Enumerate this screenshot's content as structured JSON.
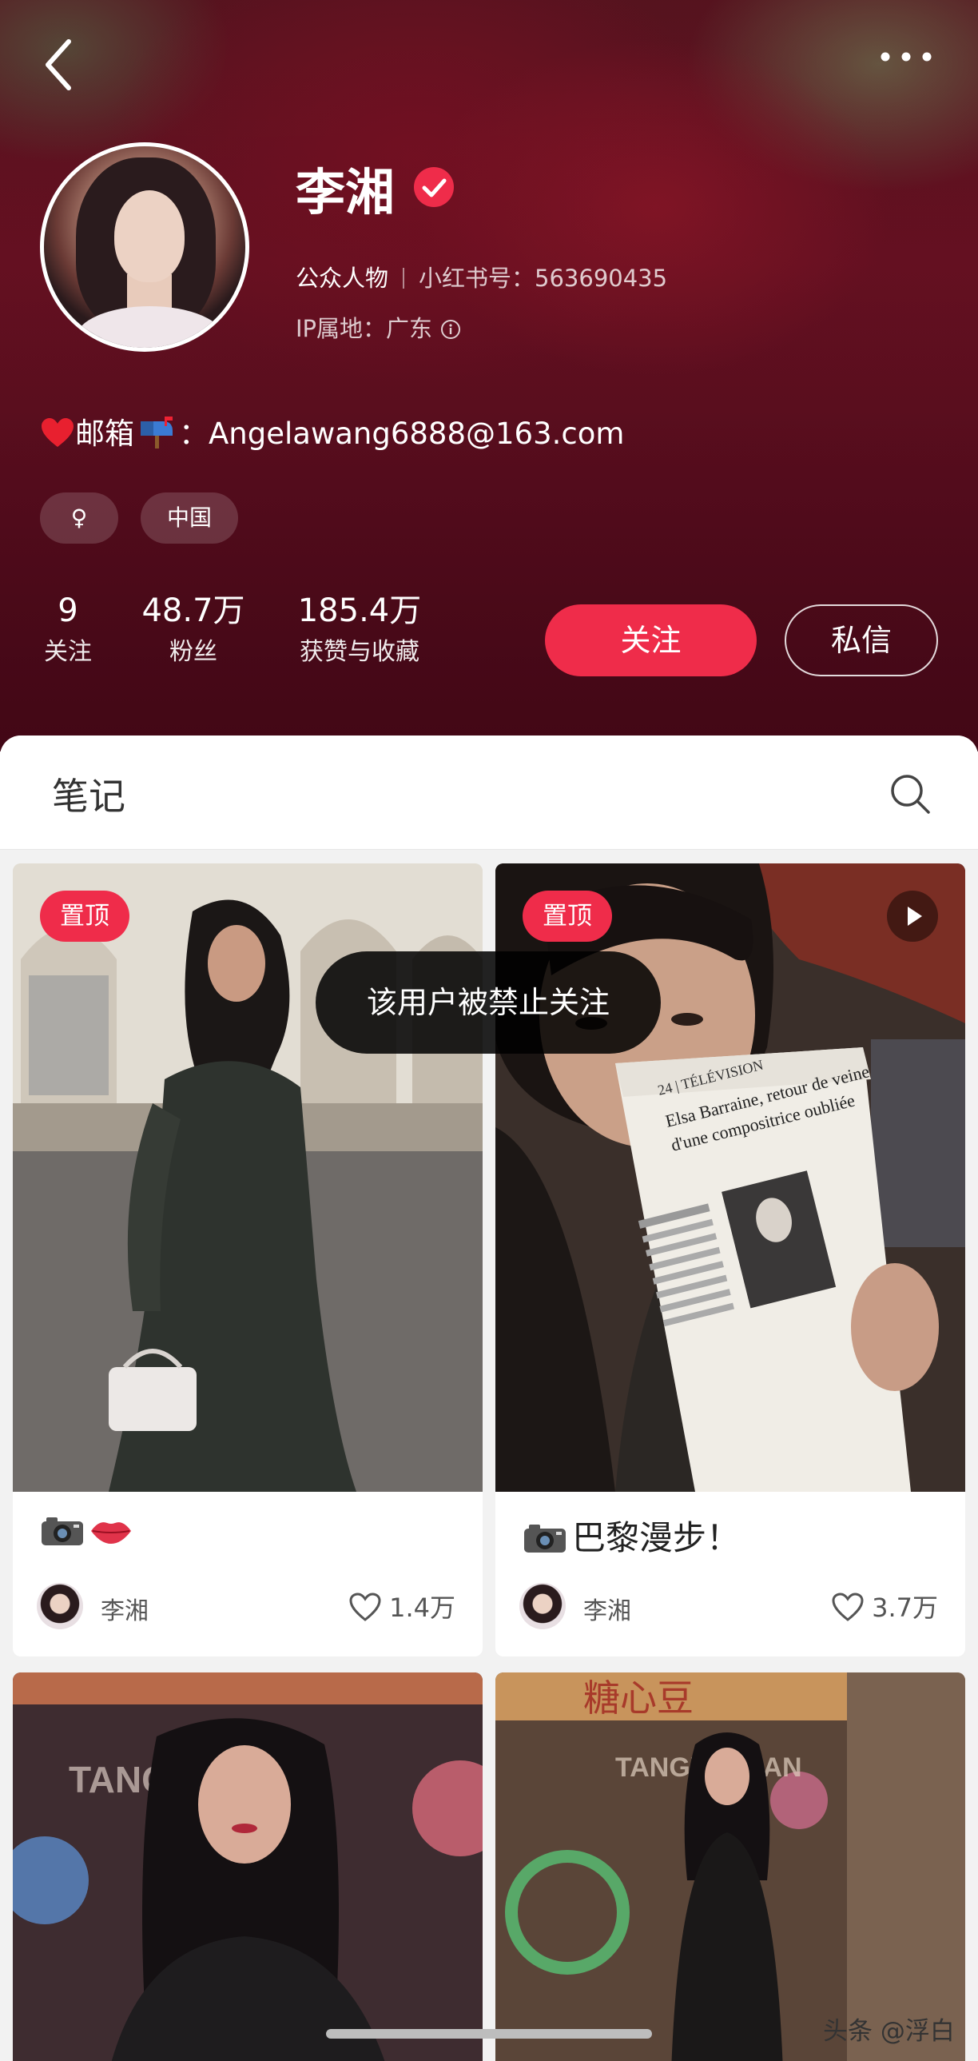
{
  "profile": {
    "name": "李湘",
    "category": "公众人物",
    "id_label": "小红书号：",
    "id_value": "563690435",
    "ip_label": "IP属地：",
    "ip_value": "广东",
    "bio_label": "邮箱",
    "bio_email": "：Angelawang6888@163.com",
    "tags": [
      "♀",
      "中国"
    ]
  },
  "stats": [
    {
      "value": "9",
      "label": "关注"
    },
    {
      "value": "48.7万",
      "label": "粉丝"
    },
    {
      "value": "185.4万",
      "label": "获赞与收藏"
    }
  ],
  "actions": {
    "follow": "关注",
    "message": "私信"
  },
  "tabs": {
    "notes": "笔记"
  },
  "posts": [
    {
      "badge": "置顶",
      "title": "",
      "author": "李湘",
      "likes": "1.4万",
      "video": false
    },
    {
      "badge": "置顶",
      "title": "巴黎漫步！",
      "author": "李湘",
      "likes": "3.7万",
      "video": true
    }
  ],
  "photo_text": {
    "newspaper_section": "24 | TÉLÉVISION",
    "newspaper_headline_1": "Elsa Barraine, retour de veine",
    "newspaper_headline_2": "d'une compositrice oubliée",
    "sign_cn": "糖心豆",
    "sign_en_1": "TANGXIN DAN",
    "sign_en_2": "TANGXIN DAN"
  },
  "toast": "该用户被禁止关注",
  "watermark": "头条 @浮白",
  "icons": [
    "back-icon",
    "more-icon",
    "verified-icon",
    "info-icon",
    "heart-emoji-icon",
    "mailbox-icon",
    "search-icon",
    "pin-badge",
    "play-icon",
    "camera-icon",
    "lips-icon",
    "heart-icon"
  ],
  "colors": {
    "accent": "#ef2c4a",
    "hero": "#6d1224"
  }
}
